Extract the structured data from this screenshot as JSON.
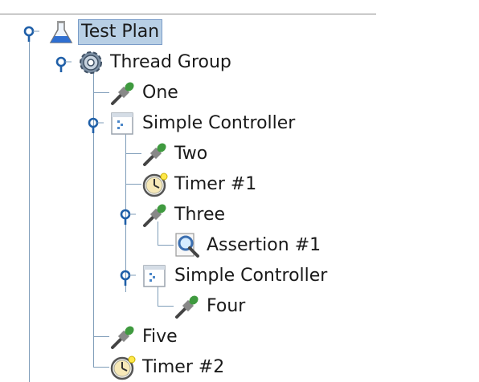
{
  "tree": {
    "root": {
      "label": "Test Plan",
      "icon": "flask-icon",
      "selected": true
    },
    "thread_group": {
      "label": "Thread Group",
      "icon": "gear-icon"
    },
    "nodes": [
      {
        "label": "One",
        "icon": "dropper-icon"
      },
      {
        "label": "Simple Controller",
        "icon": "controller-icon"
      },
      {
        "label": "Two",
        "icon": "dropper-icon"
      },
      {
        "label": "Timer #1",
        "icon": "clock-icon"
      },
      {
        "label": "Three",
        "icon": "dropper-icon"
      },
      {
        "label": "Assertion #1",
        "icon": "magnifier-icon"
      },
      {
        "label": "Simple Controller",
        "icon": "controller-icon"
      },
      {
        "label": "Four",
        "icon": "dropper-icon"
      },
      {
        "label": "Five",
        "icon": "dropper-icon"
      },
      {
        "label": "Timer #2",
        "icon": "clock-icon"
      }
    ]
  },
  "colors": {
    "selection": "#b8cfe5",
    "line": "#7f9db9",
    "toggle": "#1f5fa8"
  }
}
